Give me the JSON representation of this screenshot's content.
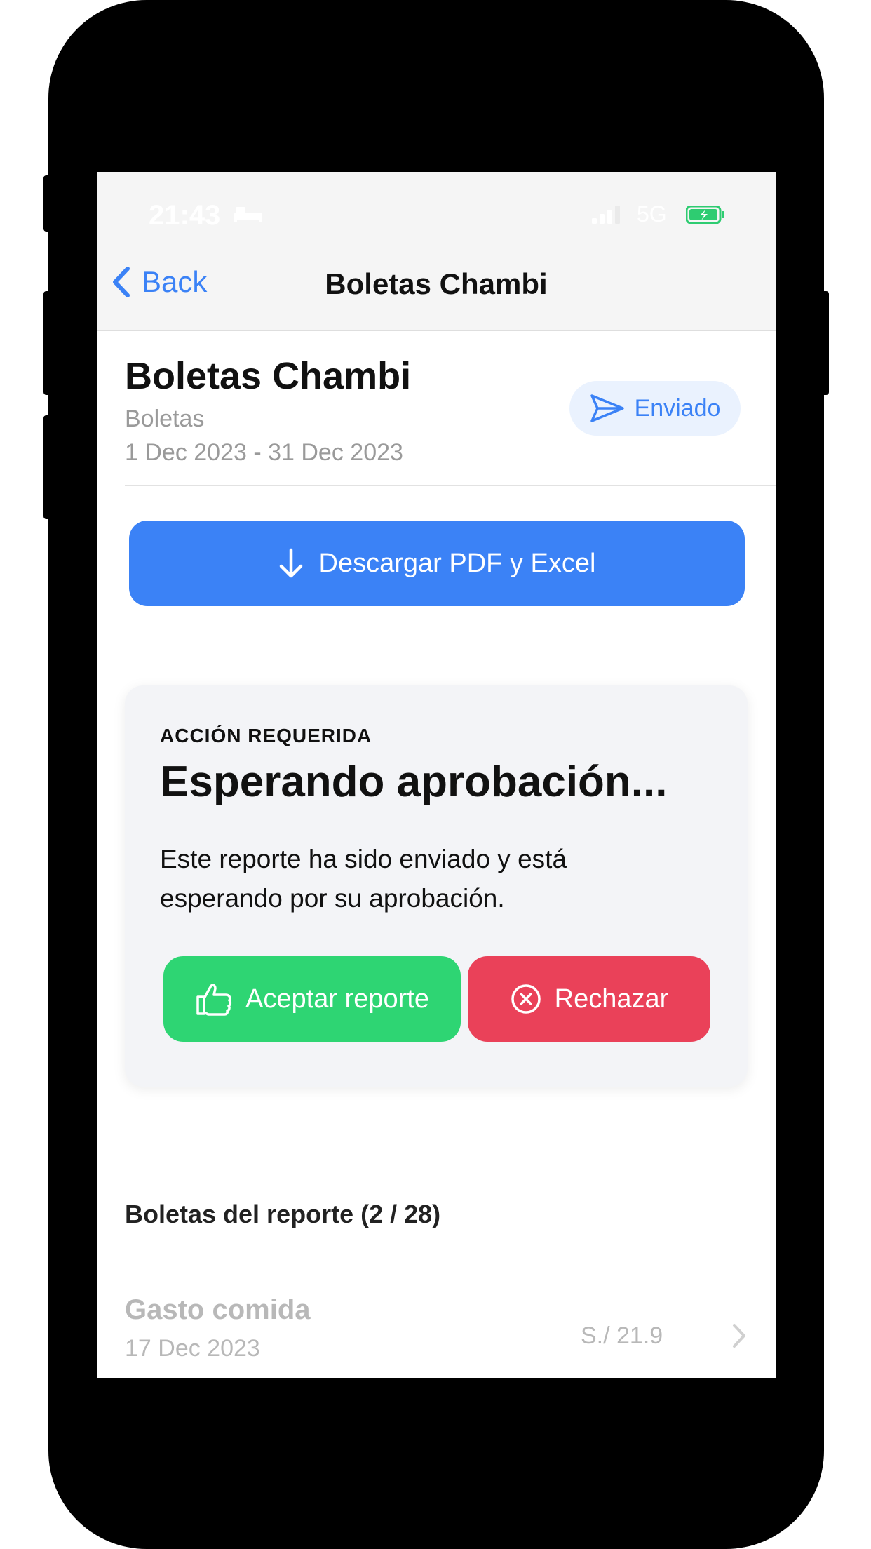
{
  "status_bar": {
    "time": "21:43",
    "network": "5G"
  },
  "nav": {
    "back_label": "Back",
    "title": "Boletas Chambi"
  },
  "report": {
    "title": "Boletas Chambi",
    "category": "Boletas",
    "date_range": "1 Dec 2023 - 31 Dec 2023",
    "status_label": "Enviado"
  },
  "download_button": {
    "label": "Descargar PDF y Excel"
  },
  "action_card": {
    "eyebrow": "ACCIÓN REQUERIDA",
    "heading": "Esperando aprobación...",
    "body": "Este reporte ha sido enviado y está esperando por su aprobación.",
    "accept_label": "Aceptar reporte",
    "reject_label": "Rechazar"
  },
  "receipts": {
    "heading": "Boletas del reporte (2 / 28)",
    "items": [
      {
        "title": "Gasto comida",
        "date": "17 Dec 2023",
        "amount": "S./ 21.9"
      }
    ]
  },
  "colors": {
    "accent": "#3b82f6",
    "accept": "#2ed573",
    "reject": "#ea4159",
    "battery": "#2ecc71"
  }
}
